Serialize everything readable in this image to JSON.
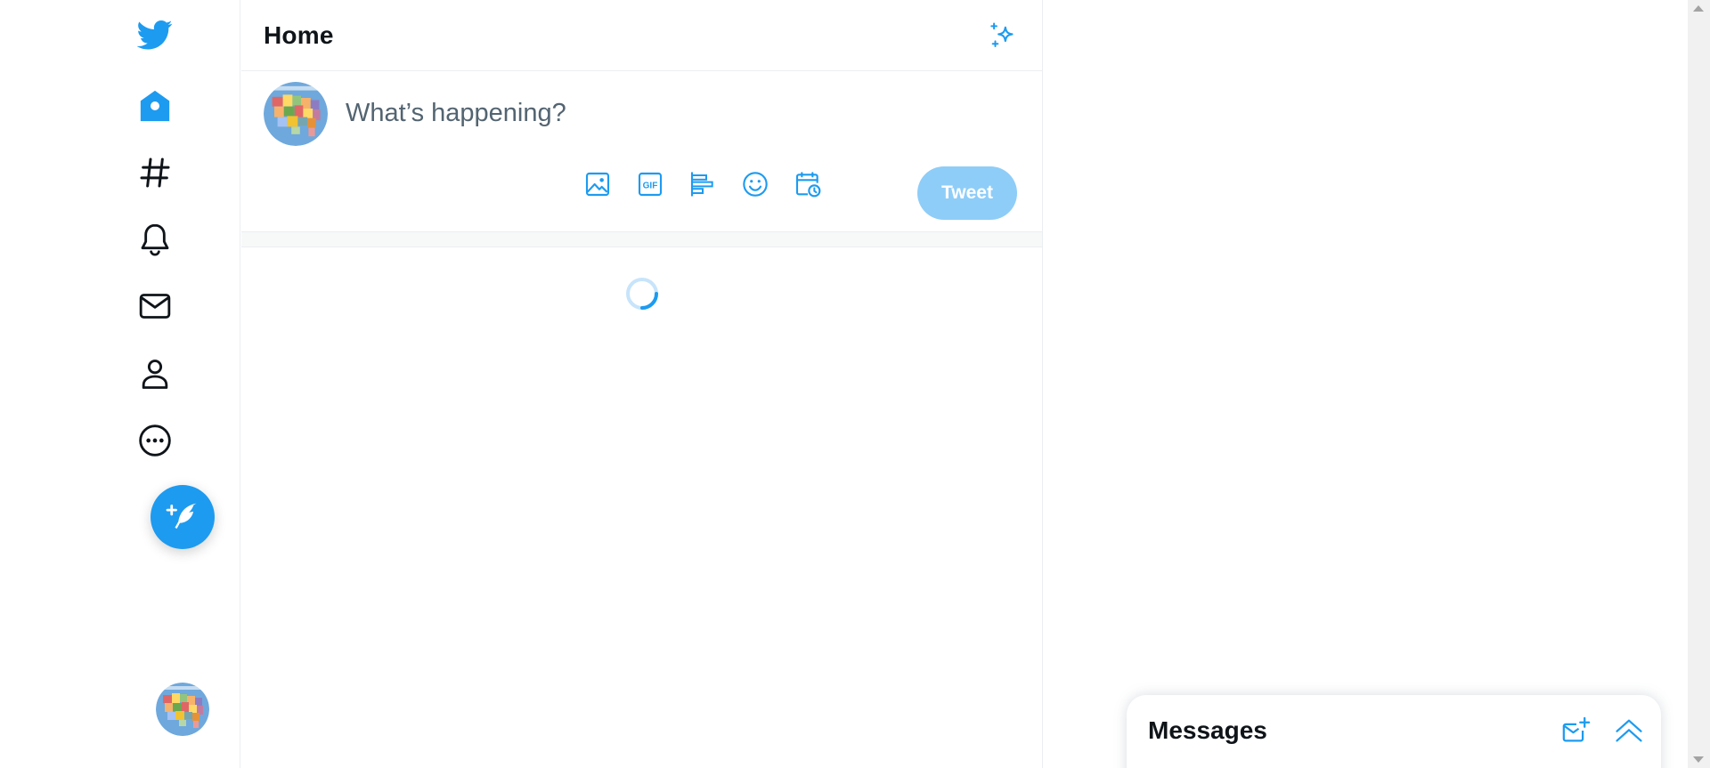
{
  "header": {
    "title": "Home"
  },
  "composer": {
    "placeholder": "What’s happening?",
    "tweet_label": "Tweet"
  },
  "nav": {
    "items": [
      {
        "icon": "twitter-logo-icon"
      },
      {
        "icon": "home-icon"
      },
      {
        "icon": "explore-hashtag-icon"
      },
      {
        "icon": "notifications-bell-icon"
      },
      {
        "icon": "messages-envelope-icon"
      },
      {
        "icon": "profile-icon"
      },
      {
        "icon": "more-icon"
      }
    ],
    "compose_icon": "compose-tweet-icon"
  },
  "messages": {
    "title": "Messages"
  },
  "colors": {
    "accent": "#1d9bf0",
    "tweet_disabled": "#8ecdf8",
    "text": "#0f1419",
    "muted": "#536471"
  }
}
